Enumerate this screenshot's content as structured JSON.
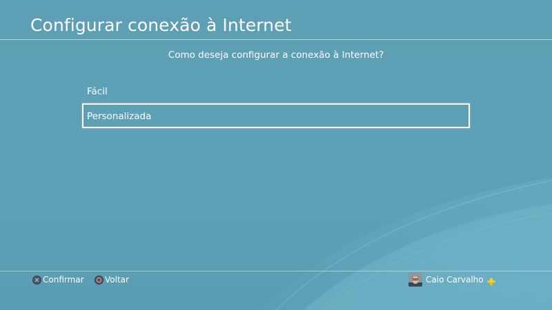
{
  "screen": {
    "title": "Configurar conexão à Internet",
    "question": "Como deseja configurar a conexão à Internet?"
  },
  "menu": {
    "items": [
      {
        "label": "Fácil",
        "selected": false
      },
      {
        "label": "Personalizada",
        "selected": true
      }
    ]
  },
  "footer": {
    "confirm_label": "Confirmar",
    "confirm_icon": "cross-button-icon",
    "back_label": "Voltar",
    "back_icon": "circle-button-icon"
  },
  "user": {
    "name": "Caio Carvalho",
    "avatar": "user-avatar-icon",
    "membership_icon": "playstation-plus-icon"
  },
  "colors": {
    "background": "#5d9fb4",
    "text": "#ffffff",
    "plus_badge": "#f4c20d"
  }
}
